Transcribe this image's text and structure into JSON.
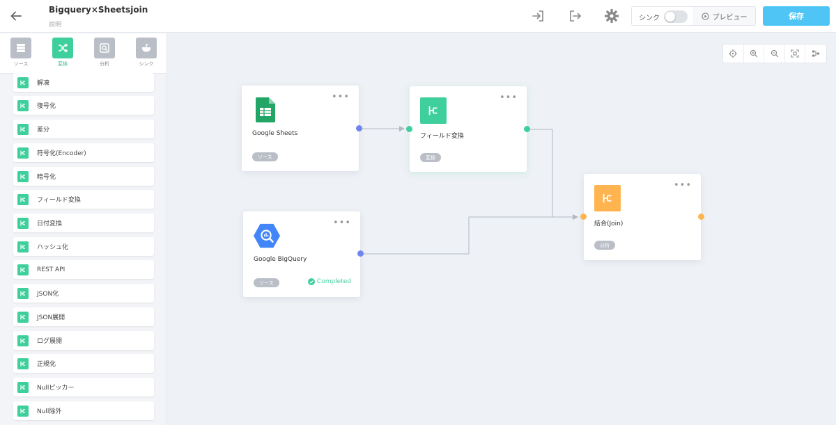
{
  "header": {
    "title": "Bigquery×Sheetsjoin",
    "subtitle": "説明",
    "sync_label": "シンク",
    "preview_label": "プレビュー",
    "save_label": "保存"
  },
  "sidebar": {
    "categories": [
      {
        "label": "ソース",
        "icon": "database-icon",
        "color": "#b9bec7"
      },
      {
        "label": "変換",
        "icon": "shuffle-icon",
        "color": "#3fcf9c"
      },
      {
        "label": "分析",
        "icon": "analytics-icon",
        "color": "#b9bec7"
      },
      {
        "label": "シンク",
        "icon": "sink-icon",
        "color": "#b9bec7"
      }
    ],
    "items": [
      {
        "label": "解凍"
      },
      {
        "label": "復号化"
      },
      {
        "label": "差分"
      },
      {
        "label": "符号化(Encoder)"
      },
      {
        "label": "暗号化"
      },
      {
        "label": "フィールド変換"
      },
      {
        "label": "日付変換"
      },
      {
        "label": "ハッシュ化"
      },
      {
        "label": "REST API"
      },
      {
        "label": "JSON化"
      },
      {
        "label": "JSON展開"
      },
      {
        "label": "ログ展開"
      },
      {
        "label": "正規化"
      },
      {
        "label": "Nullピッカー"
      },
      {
        "label": "Null除外"
      }
    ]
  },
  "canvas": {
    "nodes": [
      {
        "name": "Google Sheets",
        "badge": "ソース",
        "status": ""
      },
      {
        "name": "フィールド変換",
        "badge": "変換",
        "status": ""
      },
      {
        "name": "Google BigQuery",
        "badge": "ソース",
        "status": "Completed"
      },
      {
        "name": "結合(Join)",
        "badge": "分析",
        "status": ""
      }
    ]
  },
  "colors": {
    "transform": "#3fcf9c",
    "source_port": "#6f86f0",
    "analysis": "#ffb44f",
    "save": "#4fc5f5",
    "badge": "#b9bec7"
  }
}
